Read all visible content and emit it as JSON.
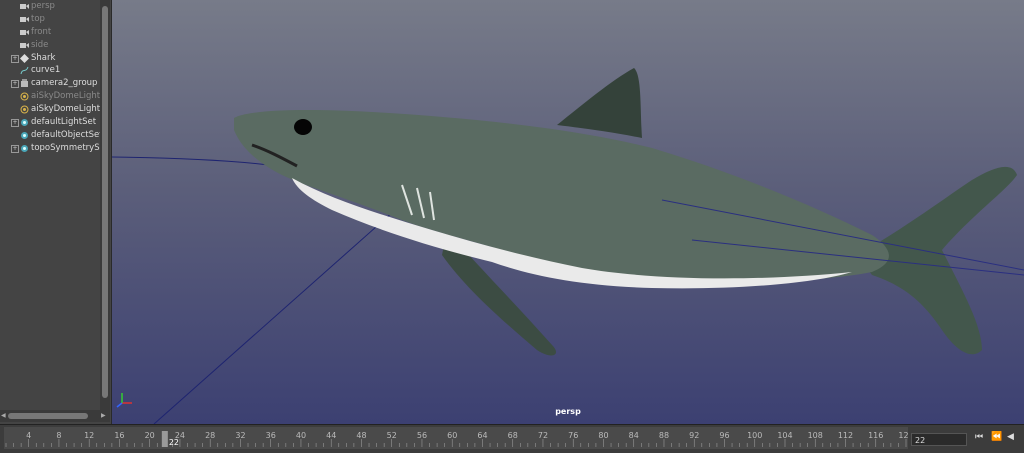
{
  "outliner": {
    "items": [
      {
        "label": "persp",
        "style": "dim",
        "icon": "camera-icon",
        "expand": ""
      },
      {
        "label": "top",
        "style": "dim",
        "icon": "camera-icon",
        "expand": ""
      },
      {
        "label": "front",
        "style": "dim",
        "icon": "camera-icon",
        "expand": ""
      },
      {
        "label": "side",
        "style": "dim",
        "icon": "camera-icon",
        "expand": ""
      },
      {
        "label": "Shark",
        "style": "",
        "icon": "transform-icon",
        "expand": "+"
      },
      {
        "label": "curve1",
        "style": "",
        "icon": "curve-icon",
        "expand": ""
      },
      {
        "label": "camera2_group",
        "style": "",
        "icon": "group-icon",
        "expand": "+"
      },
      {
        "label": "aiSkyDomeLight1",
        "style": "dim",
        "icon": "light-icon",
        "expand": ""
      },
      {
        "label": "aiSkyDomeLight2",
        "style": "",
        "icon": "light-icon",
        "expand": ""
      },
      {
        "label": "defaultLightSet",
        "style": "",
        "icon": "set-icon",
        "expand": "+"
      },
      {
        "label": "defaultObjectSet",
        "style": "",
        "icon": "set-icon",
        "expand": ""
      },
      {
        "label": "topoSymmetrySet",
        "style": "",
        "icon": "set-icon",
        "expand": "+"
      }
    ]
  },
  "viewport": {
    "camera_label": "persp"
  },
  "timeline": {
    "ticks": [
      "4",
      "8",
      "12",
      "16",
      "20",
      "24",
      "28",
      "32",
      "36",
      "40",
      "44",
      "48",
      "52",
      "56",
      "60",
      "64",
      "68",
      "72",
      "76",
      "80",
      "84",
      "88",
      "92",
      "96",
      "100",
      "104",
      "108",
      "112",
      "116",
      "120"
    ],
    "range_start": 1,
    "range_end": 120,
    "current_frame": 22,
    "current_frame_label": "22",
    "current_frame_field": "22"
  },
  "colors": {
    "viewport_top": "#777b89",
    "viewport_bottom": "#3c4072",
    "panel": "#444444"
  }
}
